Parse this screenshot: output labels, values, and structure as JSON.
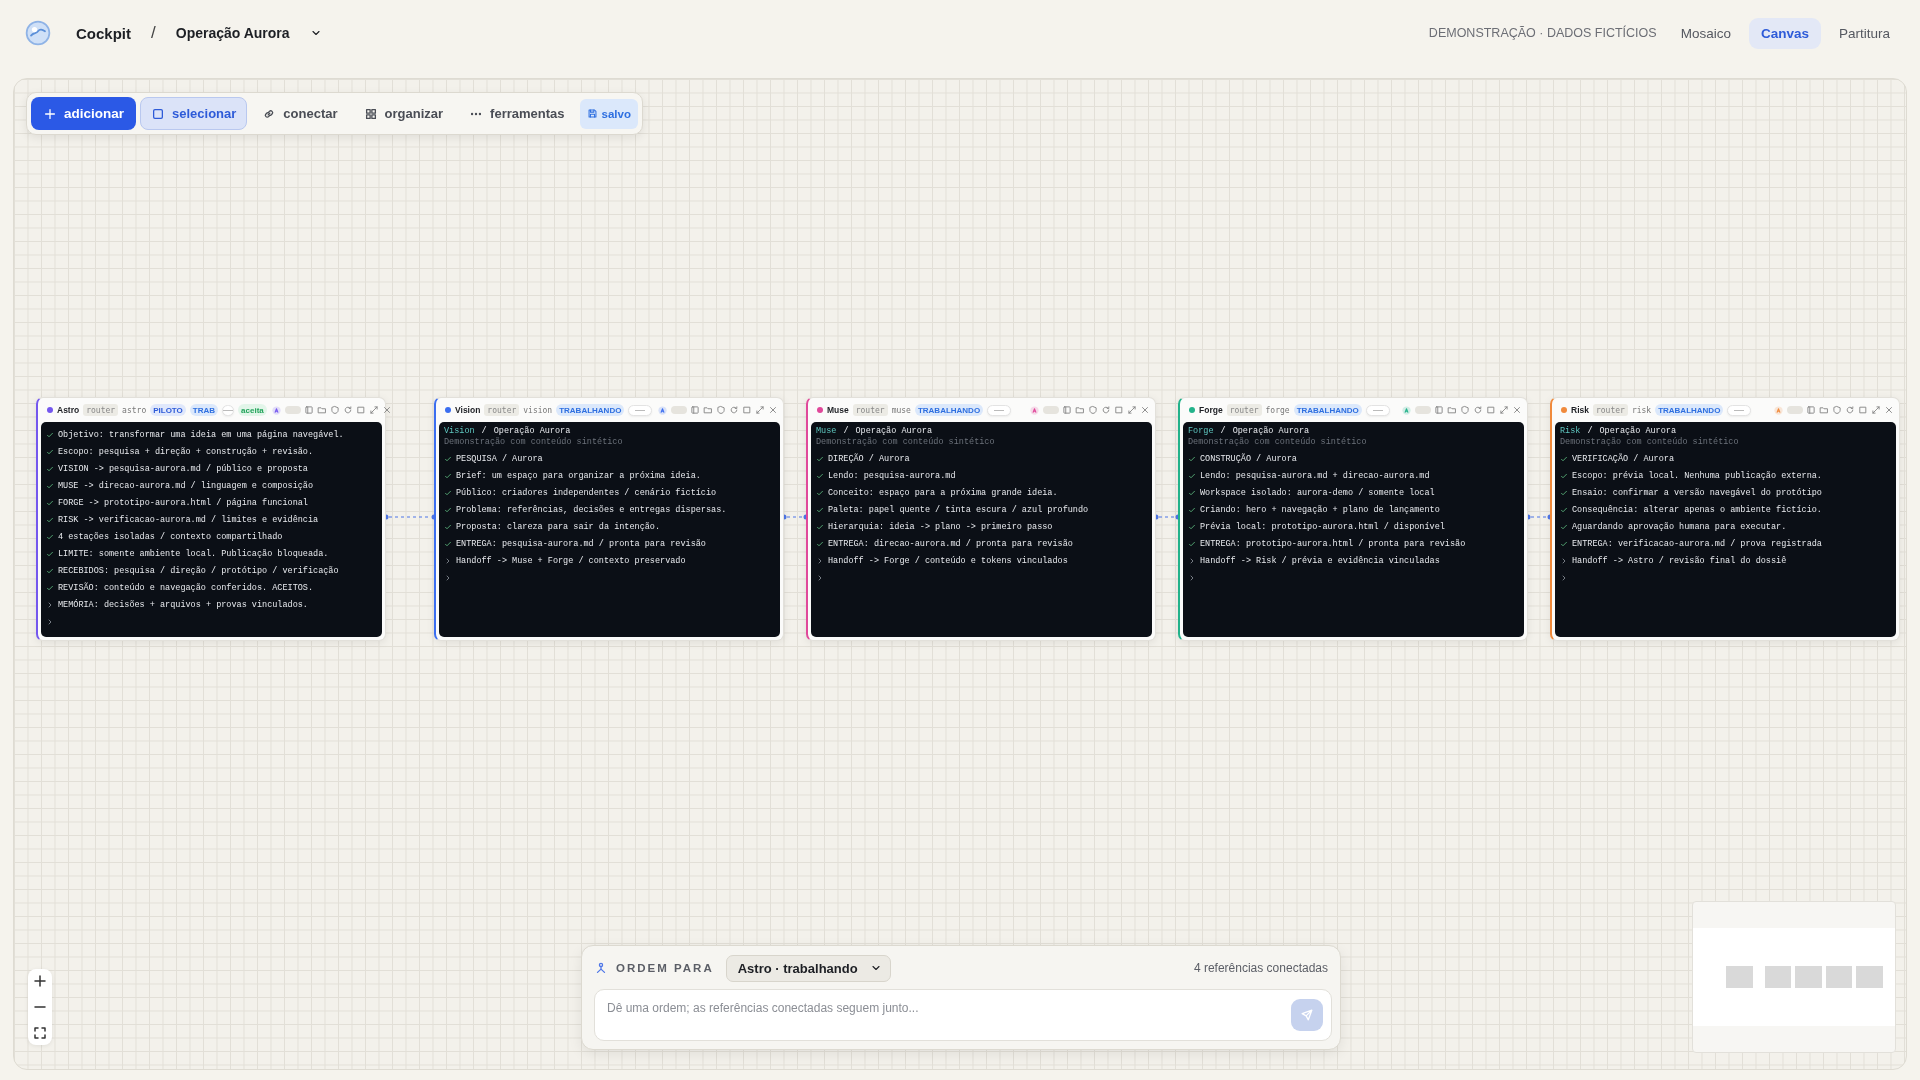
{
  "header": {
    "app": "Cockpit",
    "separator": "/",
    "project": "Operação Aurora",
    "notice": "DEMONSTRAÇÃO · DADOS FICTÍCIOS",
    "views": [
      {
        "label": "Mosaico",
        "selected": false
      },
      {
        "label": "Canvas",
        "selected": true
      },
      {
        "label": "Partitura",
        "selected": false
      }
    ]
  },
  "toolbar": [
    {
      "label": "adicionar",
      "kind": "primary",
      "selected": false
    },
    {
      "label": "selecionar",
      "kind": "tool",
      "selected": true
    },
    {
      "label": "conectar",
      "kind": "tool",
      "selected": false
    },
    {
      "label": "organizar",
      "kind": "tool",
      "selected": false
    },
    {
      "label": "ferramentas",
      "kind": "tool",
      "selected": false
    },
    {
      "label": "salvo",
      "kind": "status",
      "selected": false
    }
  ],
  "nodes": [
    {
      "name": "Astro",
      "color": "#7457ee",
      "route": "router",
      "agent": "astro",
      "role": "PILOTO",
      "status": "TRAB",
      "accepted": "aceita",
      "lines": [
        {
          "text": "Objetivo: transformar uma ideia em uma página navegável.",
          "done": true
        },
        {
          "text": "Escopo: pesquisa + direção + construção + revisão.",
          "done": true
        },
        {
          "text": "VISION  -> pesquisa-aurora.md / público e proposta",
          "done": true
        },
        {
          "text": "MUSE    -> direcao-aurora.md / linguagem e composição",
          "done": true
        },
        {
          "text": "FORGE   -> prototipo-aurora.html / página funcional",
          "done": true
        },
        {
          "text": "RISK    -> verificacao-aurora.md / limites e evidência",
          "done": true
        },
        {
          "text": "4 estações isoladas / contexto compartilhado",
          "done": true
        },
        {
          "text": "LIMITE: somente ambiente local. Publicação bloqueada.",
          "done": true
        },
        {
          "text": "RECEBIDOS: pesquisa / direção / protótipo / verificação",
          "done": true
        },
        {
          "text": "REVISÃO: conteúdo e navegação conferidos. ACEITOS.",
          "done": true
        },
        {
          "text": "MEMÓRIA: decisões + arquivos + provas vinculados.",
          "done": false
        }
      ]
    },
    {
      "name": "Vision",
      "color": "#3b6ef0",
      "route": "router",
      "agent": "vision",
      "status": "TRABALHANDO",
      "title_agent": "Vision",
      "title_sep": "/",
      "title_project": "Operação Aurora",
      "subtitle": "Demonstração com conteúdo sintético",
      "lines": [
        {
          "text": "PESQUISA / Aurora",
          "done": true
        },
        {
          "text": "Brief: um espaço para organizar a próxima ideia.",
          "done": true
        },
        {
          "text": "Público: criadores independentes / cenário fictício",
          "done": true
        },
        {
          "text": "Problema: referências, decisões e entregas dispersas.",
          "done": true
        },
        {
          "text": "Proposta: clareza para sair da intenção.",
          "done": true
        },
        {
          "text": "ENTREGA: pesquisa-aurora.md / pronta para revisão",
          "done": true
        },
        {
          "text": "Handoff -> Muse + Forge / contexto preservado",
          "done": false
        }
      ]
    },
    {
      "name": "Muse",
      "color": "#e0489a",
      "route": "router",
      "agent": "muse",
      "status": "TRABALHANDO",
      "title_agent": "Muse",
      "title_sep": "/",
      "title_project": "Operação Aurora",
      "subtitle": "Demonstração com conteúdo sintético",
      "lines": [
        {
          "text": "DIREÇÃO / Aurora",
          "done": true
        },
        {
          "text": "Lendo: pesquisa-aurora.md",
          "done": true
        },
        {
          "text": "Conceito: espaço para a próxima grande ideia.",
          "done": true
        },
        {
          "text": "Paleta: papel quente / tinta escura / azul profundo",
          "done": true
        },
        {
          "text": "Hierarquia: ideia -> plano -> primeiro passo",
          "done": true
        },
        {
          "text": "ENTREGA: direcao-aurora.md / pronta para revisão",
          "done": true
        },
        {
          "text": "Handoff -> Forge / conteúdo e tokens vinculados",
          "done": false
        }
      ]
    },
    {
      "name": "Forge",
      "color": "#22b28a",
      "route": "router",
      "agent": "forge",
      "status": "TRABALHANDO",
      "title_agent": "Forge",
      "title_sep": "/",
      "title_project": "Operação Aurora",
      "subtitle": "Demonstração com conteúdo sintético",
      "lines": [
        {
          "text": "CONSTRUÇÃO / Aurora",
          "done": true
        },
        {
          "text": "Lendo: pesquisa-aurora.md + direcao-aurora.md",
          "done": true
        },
        {
          "text": "Workspace isolado: aurora-demo / somente local",
          "done": true
        },
        {
          "text": "Criando: hero + navegação + plano de lançamento",
          "done": true
        },
        {
          "text": "Prévia local: prototipo-aurora.html / disponível",
          "done": true
        },
        {
          "text": "ENTREGA: prototipo-aurora.html / pronta para revisão",
          "done": true
        },
        {
          "text": "Handoff -> Risk / prévia e evidência vinculadas",
          "done": false
        }
      ]
    },
    {
      "name": "Risk",
      "color": "#f08a3c",
      "route": "router",
      "agent": "risk",
      "status": "TRABALHANDO",
      "title_agent": "Risk",
      "title_sep": "/",
      "title_project": "Operação Aurora",
      "subtitle": "Demonstração com conteúdo sintético",
      "lines": [
        {
          "text": "VERIFICAÇÃO / Aurora",
          "done": true
        },
        {
          "text": "Escopo: prévia local. Nenhuma publicação externa.",
          "done": true
        },
        {
          "text": "Ensaio: confirmar a versão navegável do protótipo",
          "done": true
        },
        {
          "text": "Consequência: alterar apenas o ambiente fictício.",
          "done": true
        },
        {
          "text": "Aguardando aprovação humana para executar.",
          "done": true
        },
        {
          "text": "ENTREGA: verificacao-aurora.md / prova registrada",
          "done": true
        },
        {
          "text": "Handoff -> Astro / revisão final do dossiê",
          "done": false
        }
      ]
    }
  ],
  "composer": {
    "label": "ORDEM PARA",
    "target": "Astro · trabalhando",
    "references": "4 referências conectadas",
    "placeholder": "Dê uma ordem; as referências conectadas seguem junto..."
  }
}
